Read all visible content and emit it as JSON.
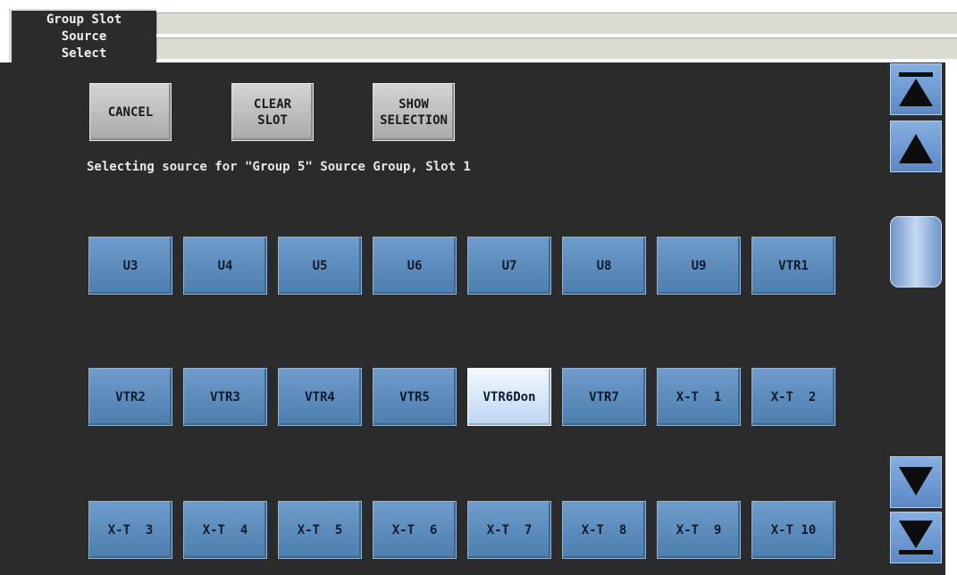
{
  "tab": {
    "label": "Group Slot\nSource\nSelect"
  },
  "controls": {
    "cancel_label": "CANCEL",
    "clear_slot_label": "CLEAR\nSLOT",
    "show_selection_label": "SHOW\nSELECTION"
  },
  "status": {
    "text": "Selecting source for \"Group 5\" Source Group, Slot 1"
  },
  "sources": [
    {
      "label": "U3"
    },
    {
      "label": "U4"
    },
    {
      "label": "U5"
    },
    {
      "label": "U6"
    },
    {
      "label": "U7"
    },
    {
      "label": "U8"
    },
    {
      "label": "U9"
    },
    {
      "label": "VTR1"
    },
    {
      "label": "VTR2"
    },
    {
      "label": "VTR3"
    },
    {
      "label": "VTR4"
    },
    {
      "label": "VTR5"
    },
    {
      "label": "VTR6Don"
    },
    {
      "label": "VTR7"
    },
    {
      "label": "X-T  1"
    },
    {
      "label": "X-T  2"
    },
    {
      "label": "X-T  3"
    },
    {
      "label": "X-T  4"
    },
    {
      "label": "X-T  5"
    },
    {
      "label": "X-T  6"
    },
    {
      "label": "X-T  7"
    },
    {
      "label": "X-T  8"
    },
    {
      "label": "X-T  9"
    },
    {
      "label": "X-T 10"
    }
  ],
  "selected_source": "VTR6Don",
  "colors": {
    "background": "#2b2b2b",
    "source_button": "#5f8ebe",
    "source_selected": "#d8e8f8",
    "control_button": "#bdbdbd",
    "scroll_button": "#6f9ad2"
  },
  "scroll_icons": {
    "top": "scroll-to-top-icon",
    "up": "scroll-up-icon",
    "down": "scroll-down-icon",
    "bottom": "scroll-to-bottom-icon"
  }
}
